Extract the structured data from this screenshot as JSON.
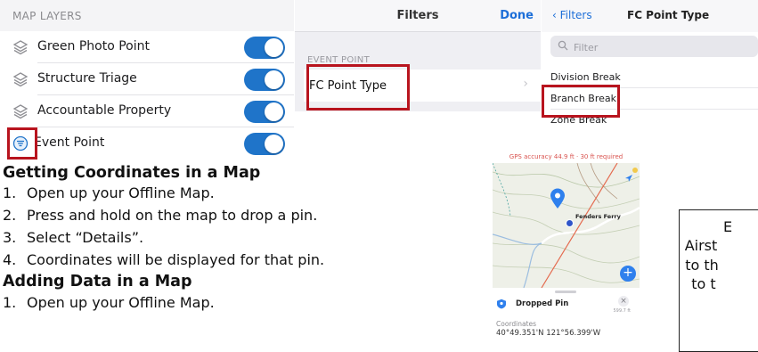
{
  "map_layers": {
    "header": "MAP LAYERS",
    "items": [
      {
        "label": "Green Photo Point",
        "icon": "layers-icon",
        "enabled": true
      },
      {
        "label": "Structure Triage",
        "icon": "layers-icon",
        "enabled": true
      },
      {
        "label": "Accountable Property",
        "icon": "layers-icon",
        "enabled": true
      },
      {
        "label": "Event Point",
        "icon": "filter-icon",
        "enabled": true
      }
    ]
  },
  "filters": {
    "title": "Filters",
    "done_label": "Done",
    "section": "EVENT POINT",
    "row_label": "FC Point Type"
  },
  "fc_point_type": {
    "back_label": "Filters",
    "title": "FC Point Type",
    "search_placeholder": "Filter",
    "items": [
      "Division Break",
      "Branch Break",
      "Zone Break"
    ]
  },
  "instructions": {
    "section1_title": "Getting Coordinates in a Map",
    "section1_steps": [
      {
        "num": "1.",
        "text": "Open up your Offline Map."
      },
      {
        "num": "2.",
        "text": "Press and hold on the map to drop a pin."
      },
      {
        "num": "3.",
        "text": "Select “Details”."
      },
      {
        "num": "4.",
        "text": "Coordinates will be displayed for that pin."
      }
    ],
    "section2_title": "Adding Data in a Map",
    "section2_steps": [
      {
        "num": "1.",
        "text": "Open up your Offline Map."
      }
    ]
  },
  "map_screenshot": {
    "gps_status": "GPS accuracy 44.9 ft · 30 ft required",
    "place_label": "Fenders Ferry",
    "pin_title": "Dropped Pin",
    "distance": "599.7 ft",
    "coords_label": "Coordinates",
    "coords_value": "40°49.351'N 121°56.399'W"
  },
  "callout": {
    "lines": [
      "E",
      "Airst",
      "to th",
      "to t"
    ]
  },
  "colors": {
    "accent_blue": "#1f74c9",
    "highlight_red": "#b8141e",
    "link_blue": "#1d6fd8",
    "gps_warning": "#d9534f"
  }
}
